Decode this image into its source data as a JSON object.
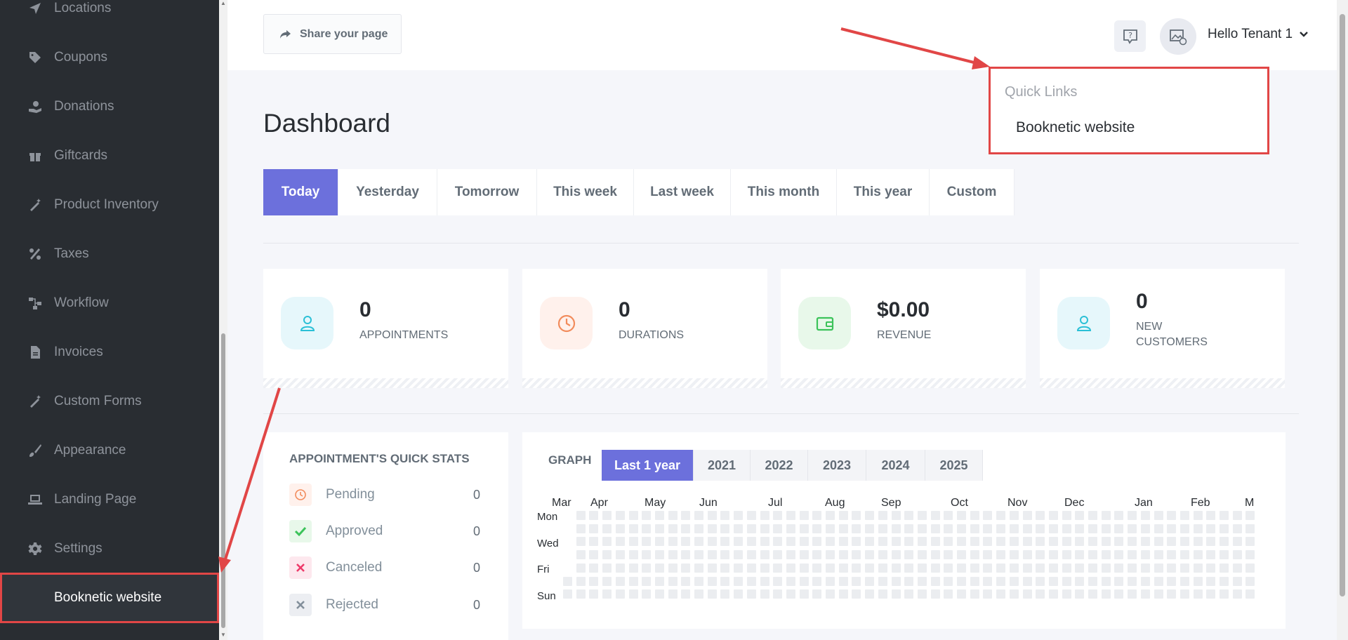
{
  "sidebar": {
    "items": [
      {
        "label": "Locations",
        "icon": "location-arrow-icon"
      },
      {
        "label": "Coupons",
        "icon": "tag-icon"
      },
      {
        "label": "Donations",
        "icon": "hand-holding-icon"
      },
      {
        "label": "Giftcards",
        "icon": "gift-icon"
      },
      {
        "label": "Product Inventory",
        "icon": "magic-wand-icon"
      },
      {
        "label": "Taxes",
        "icon": "percent-icon"
      },
      {
        "label": "Workflow",
        "icon": "workflow-icon"
      },
      {
        "label": "Invoices",
        "icon": "file-icon"
      },
      {
        "label": "Custom Forms",
        "icon": "magic-wand-icon"
      },
      {
        "label": "Appearance",
        "icon": "brush-icon"
      },
      {
        "label": "Landing Page",
        "icon": "laptop-icon"
      },
      {
        "label": "Settings",
        "icon": "gear-icon"
      },
      {
        "label": "Booknetic website",
        "icon": ""
      }
    ]
  },
  "header": {
    "share_label": "Share your page",
    "greeting": "Hello Tenant 1"
  },
  "quick_links": {
    "title": "Quick Links",
    "link": "Booknetic website"
  },
  "page_title": "Dashboard",
  "range_tabs": [
    "Today",
    "Yesterday",
    "Tomorrow",
    "This week",
    "Last week",
    "This month",
    "This year",
    "Custom"
  ],
  "cards": [
    {
      "value": "0",
      "label": "APPOINTMENTS",
      "icon": "user-icon",
      "bg": "#e6f7fb",
      "fg": "#2bc0d6"
    },
    {
      "value": "0",
      "label": "DURATIONS",
      "icon": "clock-icon",
      "bg": "#fff1ec",
      "fg": "#f28c5c"
    },
    {
      "value": "$0.00",
      "label": "REVENUE",
      "icon": "wallet-icon",
      "bg": "#e8f8ea",
      "fg": "#3cc35a"
    },
    {
      "value": "0",
      "label": "NEW CUSTOMERS",
      "icon": "user-icon",
      "bg": "#e6f7fb",
      "fg": "#2bc0d6"
    }
  ],
  "quick_stats": {
    "title": "APPOINTMENT'S QUICK STATS",
    "rows": [
      {
        "name": "Pending",
        "count": "0"
      },
      {
        "name": "Approved",
        "count": "0"
      },
      {
        "name": "Canceled",
        "count": "0"
      },
      {
        "name": "Rejected",
        "count": "0"
      }
    ]
  },
  "graph": {
    "label": "GRAPH",
    "tabs": [
      "Last 1 year",
      "2021",
      "2022",
      "2023",
      "2024",
      "2025"
    ],
    "months": [
      "Mar",
      "Apr",
      "May",
      "Jun",
      "Jul",
      "Aug",
      "Sep",
      "Oct",
      "Nov",
      "Dec",
      "Jan",
      "Feb",
      "M"
    ],
    "days": [
      "Mon",
      "Wed",
      "Fri",
      "Sun"
    ]
  },
  "colors": {
    "accent": "#6c70dc",
    "annotation": "#e14646"
  }
}
